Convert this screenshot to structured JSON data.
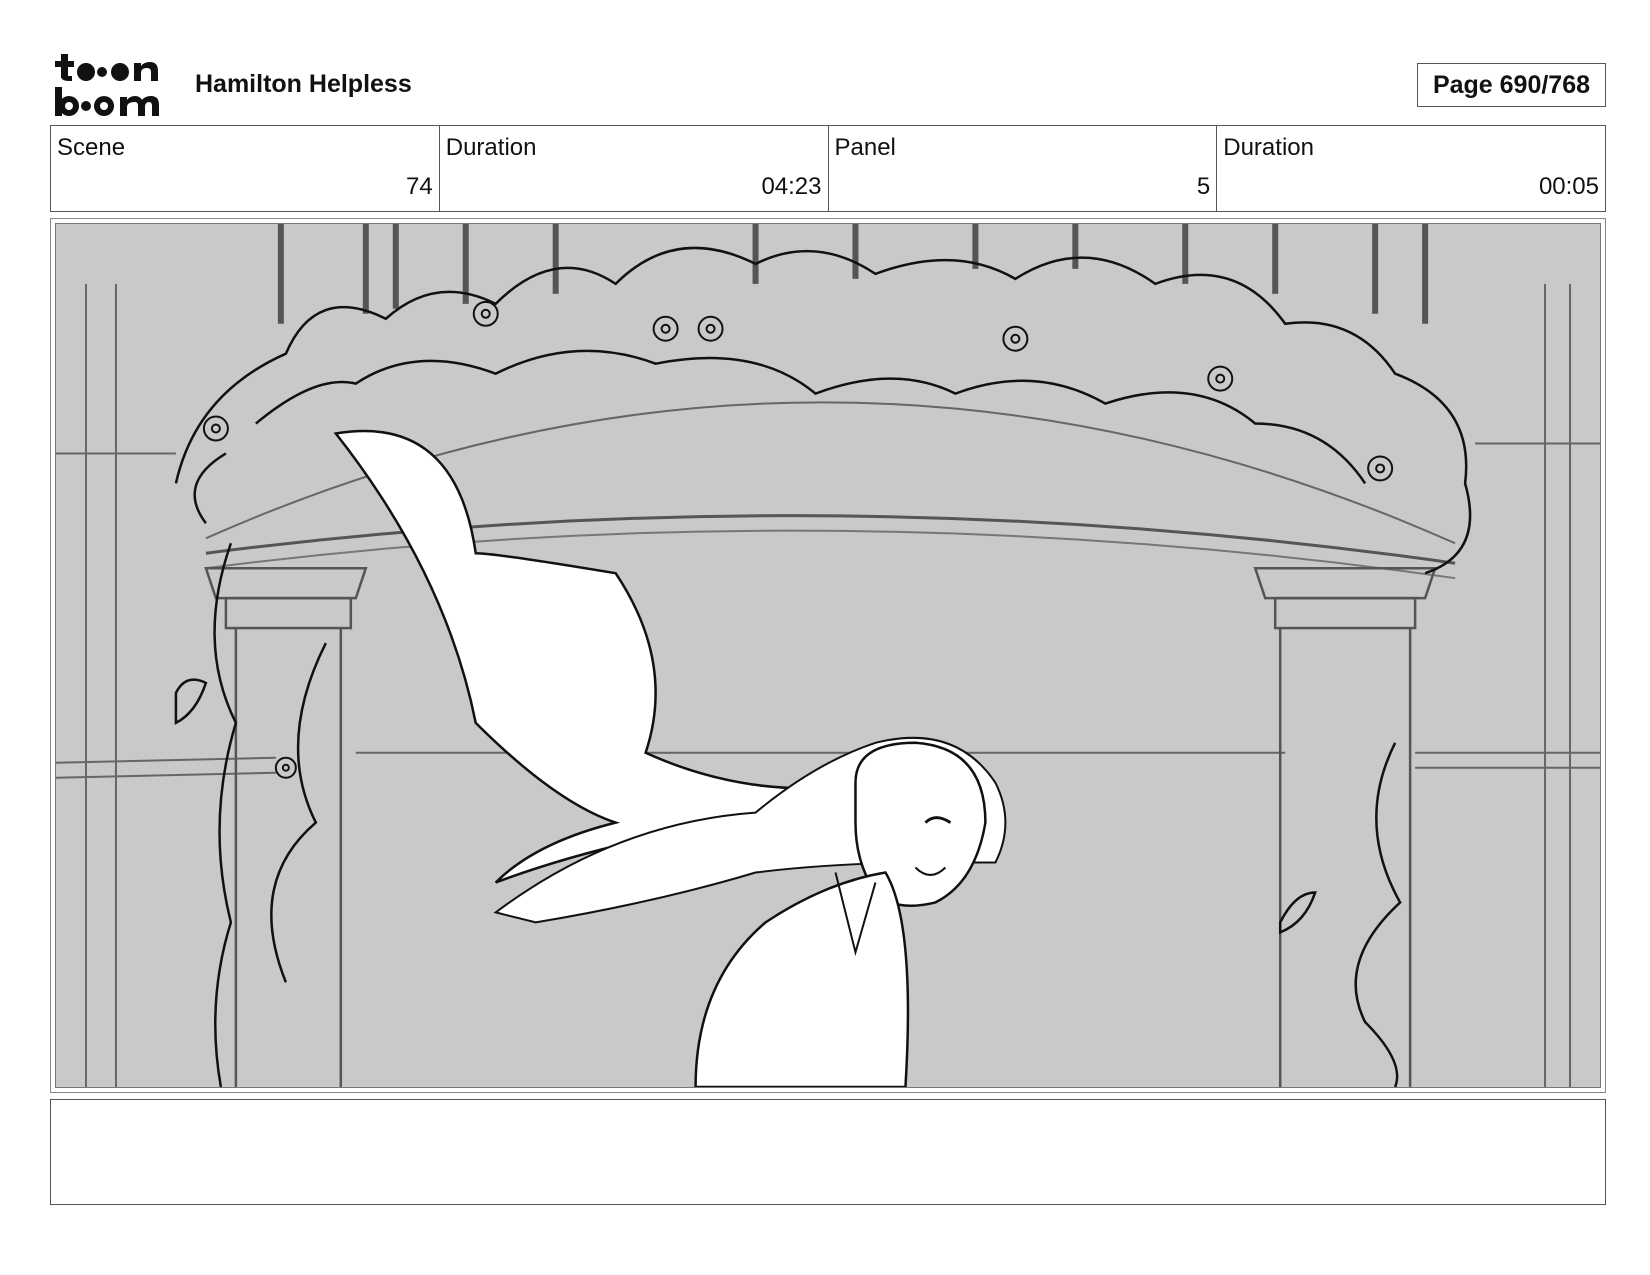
{
  "header": {
    "logo_icon": "toonboom-logo",
    "project_title": "Hamilton Helpless",
    "page_label": "Page 690/768"
  },
  "info": {
    "scene_label": "Scene",
    "scene_value": "74",
    "scene_duration_label": "Duration",
    "scene_duration_value": "04:23",
    "panel_label": "Panel",
    "panel_value": "5",
    "panel_duration_label": "Duration",
    "panel_duration_value": "00:05"
  },
  "panel": {
    "image_icon": "storyboard-sketch",
    "background_color": "#c9c9c9"
  },
  "notes": {
    "text": ""
  }
}
